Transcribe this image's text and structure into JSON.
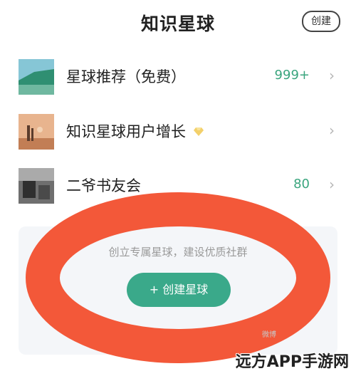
{
  "header": {
    "title": "知识星球",
    "create_label": "创建"
  },
  "list": [
    {
      "label": "星球推荐（免费）",
      "count": "999+",
      "icon": "chevron-right-icon"
    },
    {
      "label": "知识星球用户增长",
      "badge": "diamond-icon",
      "icon": "chevron-right-icon"
    },
    {
      "label": "二爷书友会",
      "count": "80",
      "icon": "chevron-right-icon"
    }
  ],
  "create_panel": {
    "tagline": "创立专属星球，建设优质社群",
    "button_label": "+ 创建星球"
  },
  "watermark": "远方APP手游网",
  "tiny_mark": "微博",
  "colors": {
    "accent": "#3aa98a",
    "count": "#3aa57e",
    "ring": "#f24f2e"
  }
}
